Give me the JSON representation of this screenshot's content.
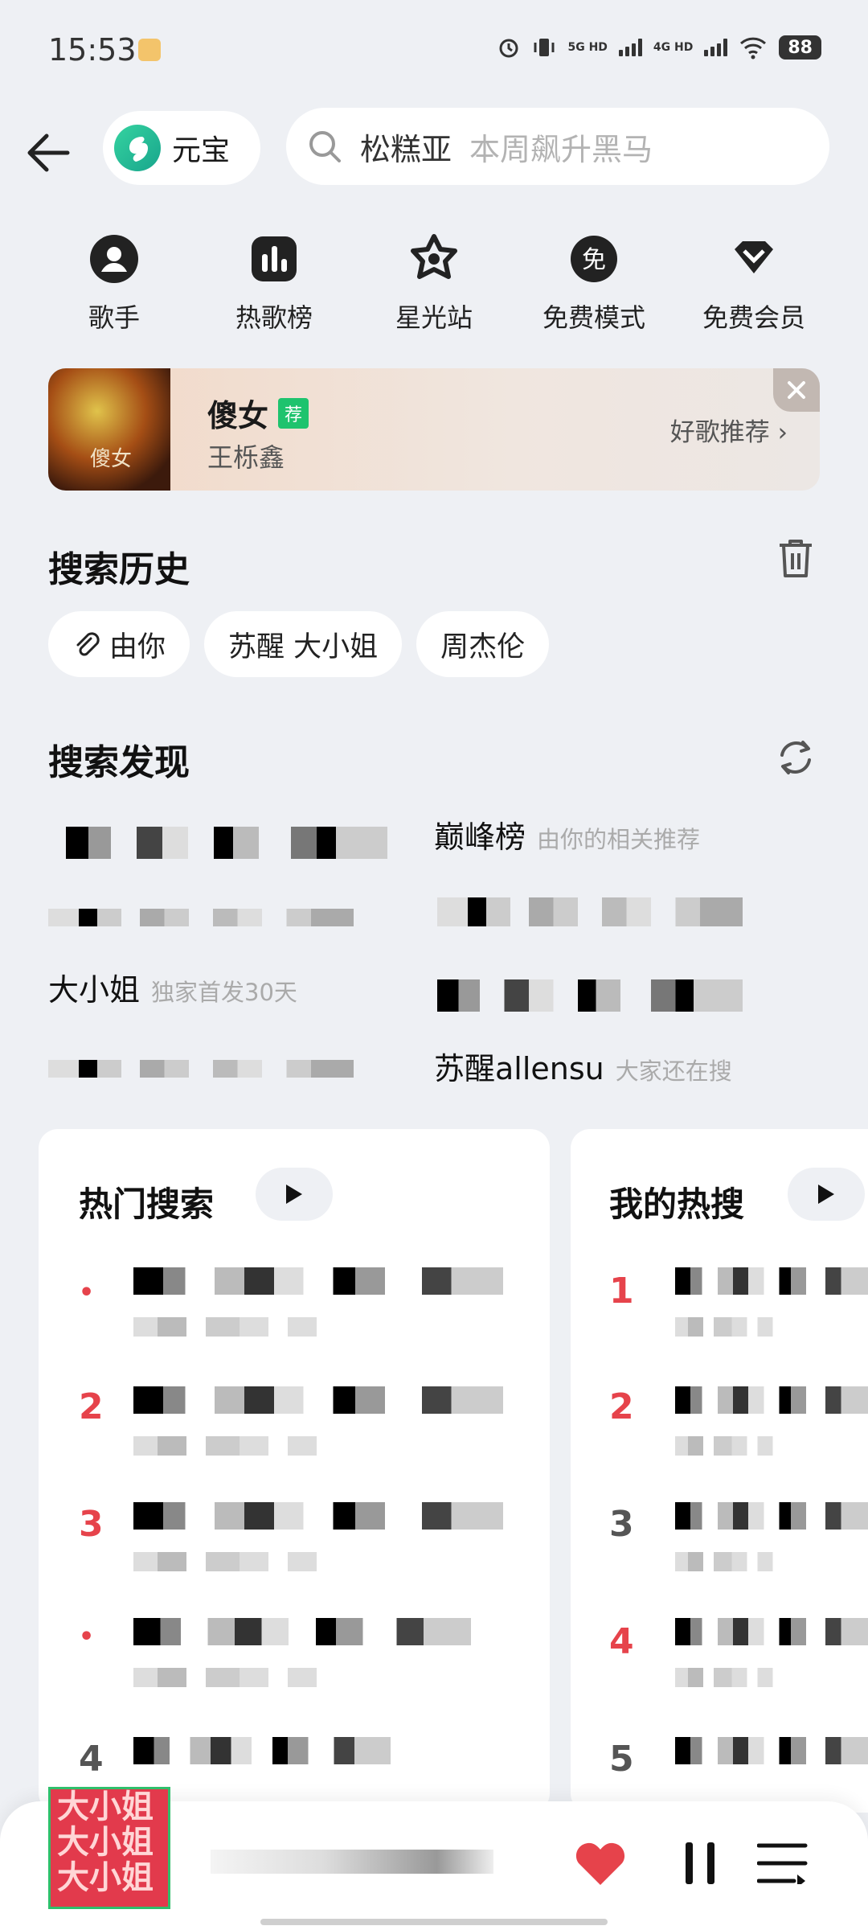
{
  "status_bar": {
    "time": "15:53",
    "sig1": "5G HD",
    "sig2": "4G HD",
    "battery": "88"
  },
  "header": {
    "yuanbao_label": "元宝",
    "search_query": "松糕亚",
    "search_hint": "本周飙升黑马"
  },
  "categories": [
    {
      "label": "歌手",
      "icon": "singer-icon"
    },
    {
      "label": "热歌榜",
      "icon": "chart-icon"
    },
    {
      "label": "星光站",
      "icon": "star-icon"
    },
    {
      "label": "免费模式",
      "icon": "free-mode-icon"
    },
    {
      "label": "免费会员",
      "icon": "diamond-icon"
    }
  ],
  "banner": {
    "song": "傻女",
    "badge": "荐",
    "artist": "王栎鑫",
    "link": "好歌推荐",
    "cover_text": "傻女"
  },
  "history": {
    "title": "搜索历史",
    "chips": [
      "由你",
      "苏醒 大小姐",
      "周杰伦"
    ]
  },
  "discover": {
    "title": "搜索发现",
    "items": [
      {
        "text": "巅峰榜",
        "sub": "由你的相关推荐"
      },
      {
        "text": "大小姐",
        "sub": "独家首发30天"
      },
      {
        "text": "苏醒allensu",
        "sub": "大家还在搜"
      }
    ]
  },
  "hot_search": {
    "title": "热门搜索",
    "ranks": [
      "2",
      "3",
      "4"
    ]
  },
  "my_hot": {
    "title": "我的热搜",
    "ranks": [
      "1",
      "2",
      "3",
      "4",
      "5"
    ]
  },
  "player": {
    "cover_text": "大小姐"
  },
  "colors": {
    "accent": "#e6434b",
    "green": "#1ec36e",
    "background": "#eef0f4"
  }
}
